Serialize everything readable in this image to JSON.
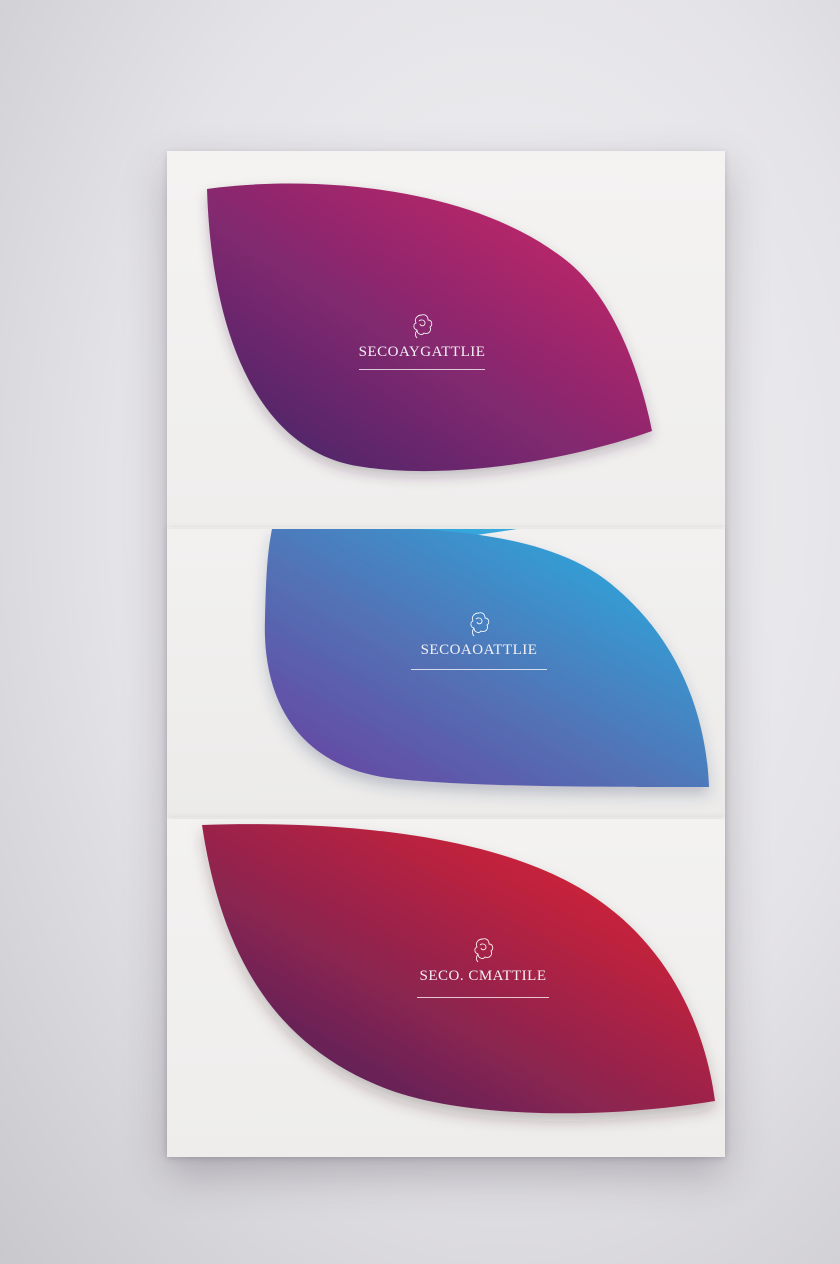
{
  "cards": [
    {
      "brand_name": "SECOAYGATTLIE",
      "tagline": "",
      "gradient": [
        "#4a2a78",
        "#9a2a6e",
        "#d02565"
      ]
    },
    {
      "brand_name": "SECOAOATTLIE",
      "tagline": "",
      "gradient": [
        "#6a4aa6",
        "#4a84c4",
        "#2aaee2"
      ]
    },
    {
      "brand_name": "SECO. CMATTILE",
      "tagline": "",
      "gradient": [
        "#4e2a86",
        "#a82448",
        "#e8222e"
      ]
    }
  ],
  "icons": {
    "logo": "rose-emblem-icon"
  }
}
